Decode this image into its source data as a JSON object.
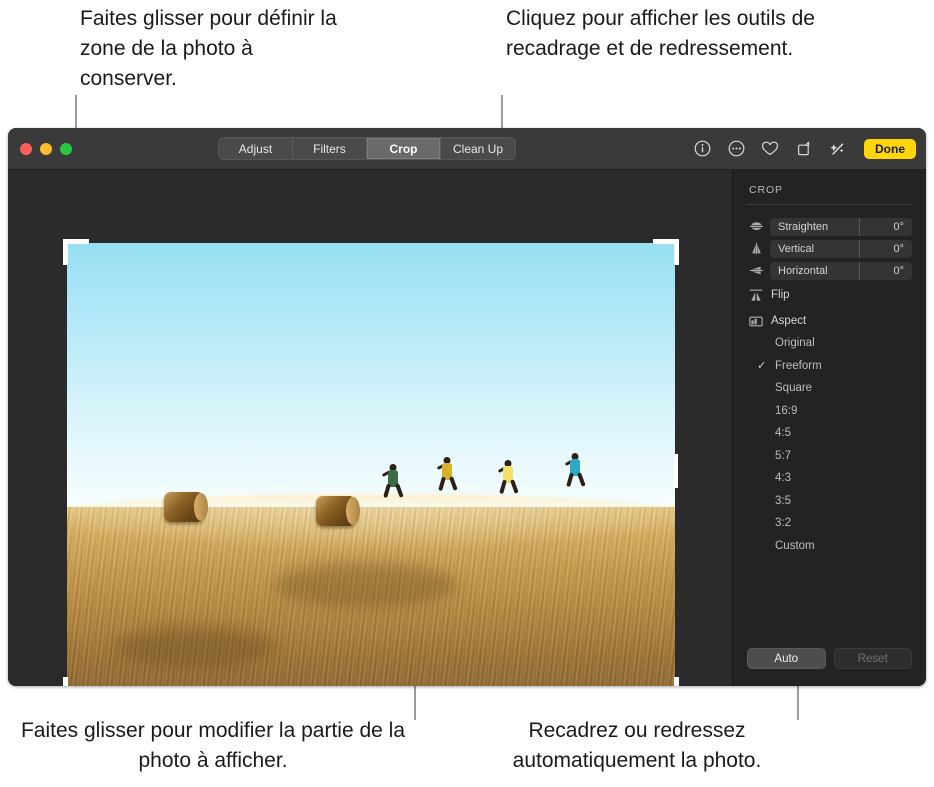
{
  "callouts": {
    "top_left": "Faites glisser pour définir la zone de la photo à conserver.",
    "top_right": "Cliquez pour afficher les outils de recadrage et de redressement.",
    "bottom_left": "Faites glisser pour modifier la partie de la photo à afficher.",
    "bottom_right": "Recadrez ou redressez automatiquement la photo."
  },
  "window": {
    "traffic_lights": [
      "close",
      "minimize",
      "zoom"
    ],
    "colors": {
      "close": "#ff5f57",
      "minimize": "#febc2e",
      "zoom": "#28c840",
      "accent_done": "#ffd60a",
      "toolbar_bg": "#3a3a3a",
      "sidebar_bg": "#232323",
      "canvas_bg": "#2b2b2b"
    }
  },
  "toolbar": {
    "tabs": [
      {
        "label": "Adjust",
        "selected": false
      },
      {
        "label": "Filters",
        "selected": false
      },
      {
        "label": "Crop",
        "selected": true
      },
      {
        "label": "Clean Up",
        "selected": false
      }
    ],
    "icons": [
      {
        "name": "info-icon"
      },
      {
        "name": "more-options-icon"
      },
      {
        "name": "favorite-heart-icon"
      },
      {
        "name": "rotate-icon"
      },
      {
        "name": "auto-enhance-wand-icon"
      }
    ],
    "done_label": "Done"
  },
  "sidebar": {
    "title": "CROP",
    "sliders": [
      {
        "icon": "straighten-icon",
        "label": "Straighten",
        "value": "0°"
      },
      {
        "icon": "vertical-perspective-icon",
        "label": "Vertical",
        "value": "0°"
      },
      {
        "icon": "horizontal-perspective-icon",
        "label": "Horizontal",
        "value": "0°"
      }
    ],
    "menus": [
      {
        "icon": "flip-icon",
        "label": "Flip"
      },
      {
        "icon": "aspect-icon",
        "label": "Aspect"
      }
    ],
    "aspect_options": [
      {
        "label": "Original",
        "selected": false
      },
      {
        "label": "Freeform",
        "selected": true
      },
      {
        "label": "Square",
        "selected": false
      },
      {
        "label": "16:9",
        "selected": false
      },
      {
        "label": "4:5",
        "selected": false
      },
      {
        "label": "5:7",
        "selected": false
      },
      {
        "label": "4:3",
        "selected": false
      },
      {
        "label": "3:5",
        "selected": false
      },
      {
        "label": "3:2",
        "selected": false
      },
      {
        "label": "Custom",
        "selected": false
      }
    ],
    "check_glyph": "✓",
    "buttons": [
      {
        "label": "Auto",
        "enabled": true
      },
      {
        "label": "Reset",
        "enabled": false
      }
    ]
  },
  "photo": {
    "description": "Four children running along a golden stubble-field ridge at sunset with two round hay bales and a pale blue sky",
    "bales": 2,
    "runners": 4
  }
}
